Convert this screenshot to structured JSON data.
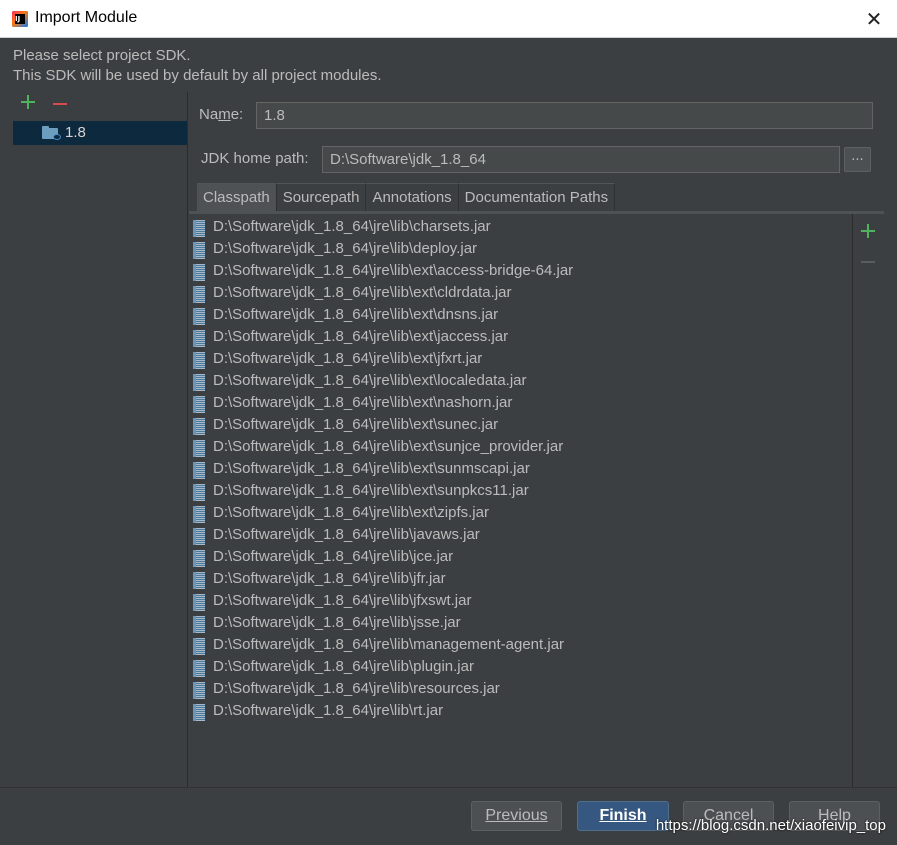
{
  "window": {
    "title": "Import Module",
    "close_glyph": "✕"
  },
  "header": {
    "line1": "Please select project SDK.",
    "line2": "This SDK will be used by default by all project modules."
  },
  "sdk_list": {
    "items": [
      {
        "label": "1.8",
        "icon": "jdk-folder-icon"
      }
    ]
  },
  "form": {
    "name_label_pre": "Na",
    "name_label_mnemonic": "m",
    "name_label_post": "e:",
    "name_value": "1.8",
    "jdk_label": "JDK home path:",
    "jdk_value": "D:\\Software\\jdk_1.8_64",
    "browse_label": "..."
  },
  "tabs": [
    {
      "label": "Classpath",
      "active": true
    },
    {
      "label": "Sourcepath",
      "active": false
    },
    {
      "label": "Annotations",
      "active": false
    },
    {
      "label": "Documentation Paths",
      "active": false
    }
  ],
  "classpath": [
    "D:\\Software\\jdk_1.8_64\\jre\\lib\\charsets.jar",
    "D:\\Software\\jdk_1.8_64\\jre\\lib\\deploy.jar",
    "D:\\Software\\jdk_1.8_64\\jre\\lib\\ext\\access-bridge-64.jar",
    "D:\\Software\\jdk_1.8_64\\jre\\lib\\ext\\cldrdata.jar",
    "D:\\Software\\jdk_1.8_64\\jre\\lib\\ext\\dnsns.jar",
    "D:\\Software\\jdk_1.8_64\\jre\\lib\\ext\\jaccess.jar",
    "D:\\Software\\jdk_1.8_64\\jre\\lib\\ext\\jfxrt.jar",
    "D:\\Software\\jdk_1.8_64\\jre\\lib\\ext\\localedata.jar",
    "D:\\Software\\jdk_1.8_64\\jre\\lib\\ext\\nashorn.jar",
    "D:\\Software\\jdk_1.8_64\\jre\\lib\\ext\\sunec.jar",
    "D:\\Software\\jdk_1.8_64\\jre\\lib\\ext\\sunjce_provider.jar",
    "D:\\Software\\jdk_1.8_64\\jre\\lib\\ext\\sunmscapi.jar",
    "D:\\Software\\jdk_1.8_64\\jre\\lib\\ext\\sunpkcs11.jar",
    "D:\\Software\\jdk_1.8_64\\jre\\lib\\ext\\zipfs.jar",
    "D:\\Software\\jdk_1.8_64\\jre\\lib\\javaws.jar",
    "D:\\Software\\jdk_1.8_64\\jre\\lib\\jce.jar",
    "D:\\Software\\jdk_1.8_64\\jre\\lib\\jfr.jar",
    "D:\\Software\\jdk_1.8_64\\jre\\lib\\jfxswt.jar",
    "D:\\Software\\jdk_1.8_64\\jre\\lib\\jsse.jar",
    "D:\\Software\\jdk_1.8_64\\jre\\lib\\management-agent.jar",
    "D:\\Software\\jdk_1.8_64\\jre\\lib\\plugin.jar",
    "D:\\Software\\jdk_1.8_64\\jre\\lib\\resources.jar",
    "D:\\Software\\jdk_1.8_64\\jre\\lib\\rt.jar"
  ],
  "buttons": {
    "previous": "Previous",
    "finish": "Finish",
    "cancel": "Cancel",
    "help": "Help"
  },
  "watermark": "https://blog.csdn.net/xiaofeivip_top",
  "colors": {
    "background": "#3c3f41",
    "selection": "#0d293e",
    "accent_add": "#4eb35c",
    "accent_remove": "#d94b4b",
    "default_button": "#365880"
  }
}
